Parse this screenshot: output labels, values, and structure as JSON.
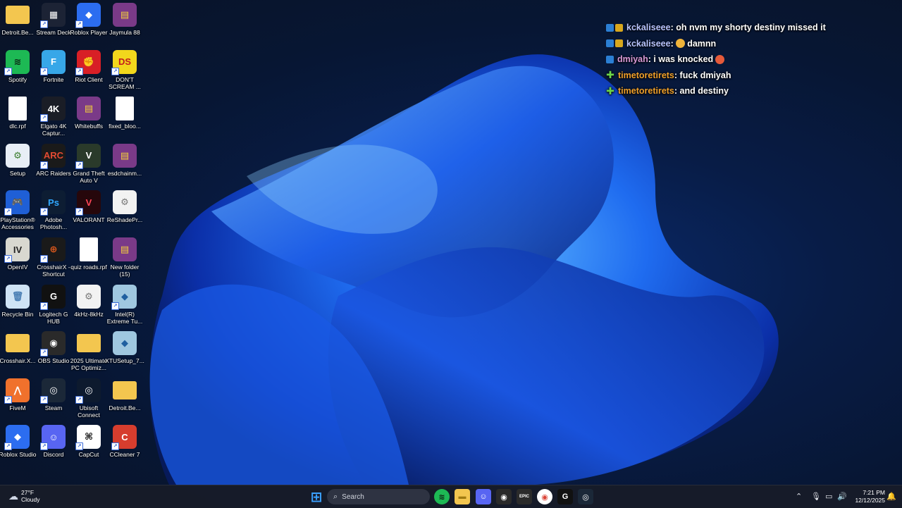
{
  "desktop": {
    "icons": [
      {
        "label": "Detroit.Be...",
        "bg": "#f3c64f",
        "fg": "#f3c64f",
        "glyph": "",
        "shortcut": false
      },
      {
        "label": "Stream Deck",
        "bg": "#1c2335",
        "fg": "#ffffff",
        "glyph": "▦",
        "shortcut": true
      },
      {
        "label": "Roblox Player",
        "bg": "#2c6df0",
        "fg": "#ffffff",
        "glyph": "◆",
        "shortcut": true
      },
      {
        "label": "Jaymula 88",
        "bg": "#7a3a88",
        "fg": "#f4d23b",
        "glyph": "▤",
        "shortcut": false
      },
      {
        "label": "Spotify",
        "bg": "#1db954",
        "fg": "#0b1f12",
        "glyph": "≋",
        "shortcut": true
      },
      {
        "label": "Fortnite",
        "bg": "#37a7e8",
        "fg": "#ffffff",
        "glyph": "F",
        "shortcut": true
      },
      {
        "label": "Riot Client",
        "bg": "#d81f26",
        "fg": "#ffffff",
        "glyph": "✊",
        "shortcut": true
      },
      {
        "label": "DON'T SCREAM ...",
        "bg": "#f2d71c",
        "fg": "#c21c1c",
        "glyph": "DS",
        "shortcut": true
      },
      {
        "label": "dlc.rpf",
        "bg": "#ffffff",
        "fg": "#999999",
        "glyph": "",
        "shortcut": false
      },
      {
        "label": "Elgato 4K Captur...",
        "bg": "#1a1d26",
        "fg": "#ffffff",
        "glyph": "4K",
        "shortcut": true
      },
      {
        "label": "Whitebuffs",
        "bg": "#7a3a88",
        "fg": "#f4d23b",
        "glyph": "▤",
        "shortcut": false
      },
      {
        "label": "fixed_bloo...",
        "bg": "#ffffff",
        "fg": "#999999",
        "glyph": "",
        "shortcut": false
      },
      {
        "label": "Setup",
        "bg": "#e8eef6",
        "fg": "#3b7d2e",
        "glyph": "⚙",
        "shortcut": false
      },
      {
        "label": "ARC Raiders",
        "bg": "#1a1a1a",
        "fg": "#e44b33",
        "glyph": "ARC",
        "shortcut": true
      },
      {
        "label": "Grand Theft Auto V",
        "bg": "#2a3a2a",
        "fg": "#ffffff",
        "glyph": "V",
        "shortcut": true
      },
      {
        "label": "esdchainm...",
        "bg": "#7a3a88",
        "fg": "#f4d23b",
        "glyph": "▤",
        "shortcut": false
      },
      {
        "label": "PlayStation® Accessories",
        "bg": "#1f5fd6",
        "fg": "#ffffff",
        "glyph": "🎮",
        "shortcut": true
      },
      {
        "label": "Adobe Photosh...",
        "bg": "#0d1d33",
        "fg": "#31a8ff",
        "glyph": "Ps",
        "shortcut": true
      },
      {
        "label": "VALORANT",
        "bg": "#26070b",
        "fg": "#fd4556",
        "glyph": "V",
        "shortcut": true
      },
      {
        "label": "ReShadePr...",
        "bg": "#f2f2f2",
        "fg": "#777777",
        "glyph": "⚙",
        "shortcut": false
      },
      {
        "label": "OpenIV",
        "bg": "#d8d8d0",
        "fg": "#222222",
        "glyph": "IV",
        "shortcut": true
      },
      {
        "label": "CrosshairX - Shortcut",
        "bg": "#1a1a1a",
        "fg": "#e25a1c",
        "glyph": "⊕",
        "shortcut": true
      },
      {
        "label": "quiz roads.rpf",
        "bg": "#ffffff",
        "fg": "#999999",
        "glyph": "",
        "shortcut": false
      },
      {
        "label": "New folder (15)",
        "bg": "#7a3a88",
        "fg": "#f4d23b",
        "glyph": "▤",
        "shortcut": false
      },
      {
        "label": "Recycle Bin",
        "bg": "#cfe3f5",
        "fg": "#4a7fb5",
        "glyph": "🗑",
        "shortcut": false
      },
      {
        "label": "Logitech G HUB",
        "bg": "#111111",
        "fg": "#ffffff",
        "glyph": "G",
        "shortcut": true
      },
      {
        "label": "4kHz-8kHz",
        "bg": "#f2f2f2",
        "fg": "#777777",
        "glyph": "⚙",
        "shortcut": false
      },
      {
        "label": "Intel(R) Extreme Tu...",
        "bg": "#9fc7e0",
        "fg": "#1f5fa0",
        "glyph": "◆",
        "shortcut": true
      },
      {
        "label": "Crosshair.X...",
        "bg": "#f3c64f",
        "fg": "#f3c64f",
        "glyph": "",
        "shortcut": false
      },
      {
        "label": "OBS Studio",
        "bg": "#2a2a2a",
        "fg": "#ffffff",
        "glyph": "◉",
        "shortcut": true
      },
      {
        "label": "2025 Ultimate PC Optimiz...",
        "bg": "#f3c64f",
        "fg": "#f3c64f",
        "glyph": "",
        "shortcut": false
      },
      {
        "label": "XTUSetup_7...",
        "bg": "#9fc7e0",
        "fg": "#1f5fa0",
        "glyph": "◆",
        "shortcut": false
      },
      {
        "label": "FiveM",
        "bg": "#f0712c",
        "fg": "#ffffff",
        "glyph": "⋀",
        "shortcut": true
      },
      {
        "label": "Steam",
        "bg": "#1b2838",
        "fg": "#ffffff",
        "glyph": "◎",
        "shortcut": true
      },
      {
        "label": "Ubisoft Connect",
        "bg": "#0d1a2e",
        "fg": "#ffffff",
        "glyph": "◎",
        "shortcut": true
      },
      {
        "label": "Detroit.Be...",
        "bg": "#f3c64f",
        "fg": "#f3c64f",
        "glyph": "",
        "shortcut": false
      },
      {
        "label": "Roblox Studio",
        "bg": "#2c6df0",
        "fg": "#ffffff",
        "glyph": "◆",
        "shortcut": true
      },
      {
        "label": "Discord",
        "bg": "#5865f2",
        "fg": "#ffffff",
        "glyph": "☺",
        "shortcut": true
      },
      {
        "label": "CapCut",
        "bg": "#ffffff",
        "fg": "#111111",
        "glyph": "⌘",
        "shortcut": true
      },
      {
        "label": "CCleaner 7",
        "bg": "#d63d2e",
        "fg": "#ffffff",
        "glyph": "C",
        "shortcut": true
      }
    ]
  },
  "chat": [
    {
      "badges": [
        "prime",
        "sub"
      ],
      "user": "kckaliseee",
      "user_color": "#b9c4ff",
      "emote_before": "",
      "message": ": oh nvm my shorty destiny missed it",
      "emote_after": ""
    },
    {
      "badges": [
        "prime",
        "sub"
      ],
      "user": "kckaliseee",
      "user_color": "#b9c4ff",
      "emote_before": "",
      "message": ": ",
      "emote_after": "",
      "emote_mid": "#f0b43a",
      "message2": "damnn"
    },
    {
      "badges": [
        "prime"
      ],
      "user": "dmiyah",
      "user_color": "#d99ad8",
      "emote_before": "",
      "message": ": i was knocked",
      "emote_after": "#e55a3a"
    },
    {
      "badges": [
        "plus"
      ],
      "user": "timetoretirets",
      "user_color": "#f0a02a",
      "emote_before": "",
      "message": ": fuck dmiyah",
      "emote_after": ""
    },
    {
      "badges": [
        "plus"
      ],
      "user": "timetoretirets",
      "user_color": "#f0a02a",
      "emote_before": "",
      "message": ": and destiny",
      "emote_after": ""
    }
  ],
  "taskbar": {
    "weather": {
      "temp": "27°F",
      "condition": "Cloudy"
    },
    "search_placeholder": "Search",
    "apps": [
      {
        "name": "start-button",
        "glyph": "⊞",
        "bg": "transparent",
        "fg": "#3aa0ff"
      },
      {
        "name": "spotify-taskbar-icon",
        "glyph": "≋",
        "bg": "#1db954",
        "fg": "#0b1f12"
      },
      {
        "name": "file-explorer-icon",
        "glyph": "▬",
        "bg": "#f3c64f",
        "fg": "#a07a10"
      },
      {
        "name": "discord-taskbar-icon",
        "glyph": "☺",
        "bg": "#5865f2",
        "fg": "#ffffff"
      },
      {
        "name": "obs-taskbar-icon",
        "glyph": "◉",
        "bg": "#2a2a2a",
        "fg": "#ffffff"
      },
      {
        "name": "epic-games-icon",
        "glyph": "EPIC",
        "bg": "#2b2b2b",
        "fg": "#ffffff"
      },
      {
        "name": "chrome-taskbar-icon",
        "glyph": "◉",
        "bg": "#ffffff",
        "fg": "#db4437"
      },
      {
        "name": "logitech-taskbar-icon",
        "glyph": "G",
        "bg": "#111111",
        "fg": "#ffffff"
      },
      {
        "name": "steam-taskbar-icon",
        "glyph": "◎",
        "bg": "#1b2838",
        "fg": "#ffffff"
      }
    ],
    "time": "7:21 PM",
    "date": "12/12/2025"
  }
}
